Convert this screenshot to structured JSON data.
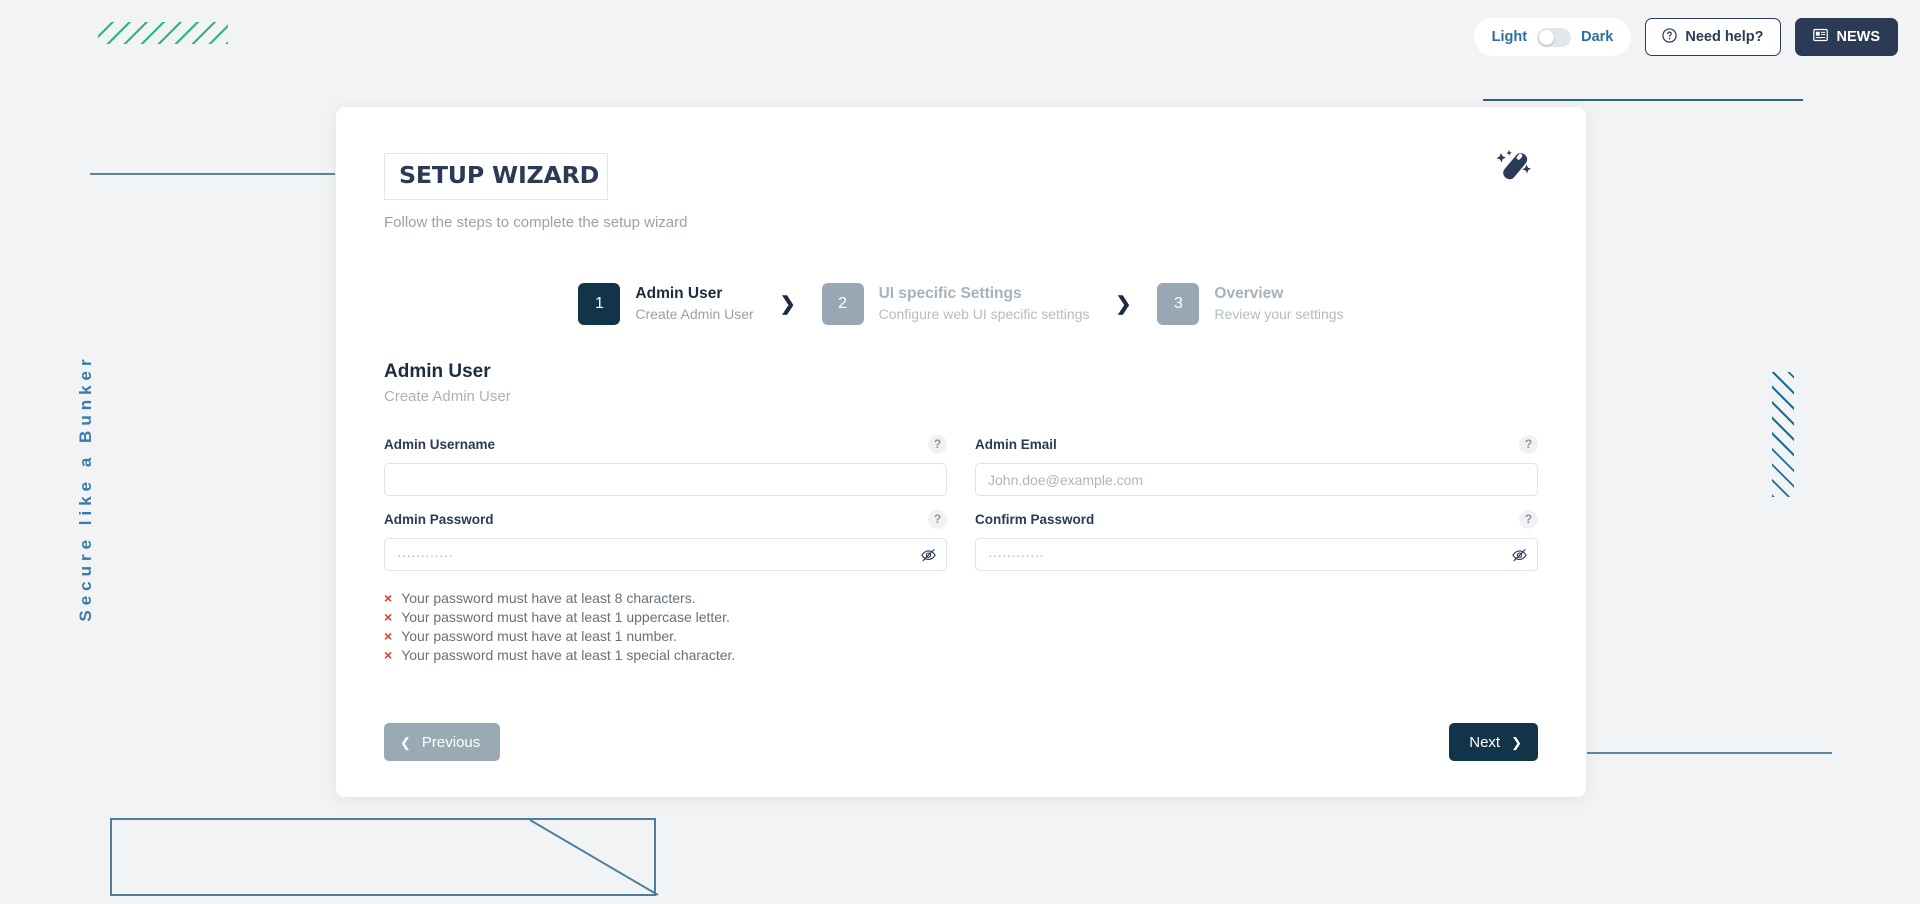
{
  "topbar": {
    "theme_light_label": "Light",
    "theme_dark_label": "Dark",
    "theme_selected": "Light",
    "help_label": "Need help?",
    "help_icon": "question-circle-icon",
    "news_label": "NEWS",
    "news_icon": "news-card-icon"
  },
  "decorations": {
    "tagline": "Secure like a Bunker",
    "green_hatch_color": "#2eb873",
    "blue_hatch_color": "#1a6f96",
    "line_color": "#5b86a3",
    "rect_color": "#4d7d9c"
  },
  "card": {
    "logo_text": "SETUP WIZARD",
    "subtitle": "Follow the steps to complete the setup wizard",
    "wand_icon": "magic-wand-icon"
  },
  "stepper": {
    "separator": "❯",
    "steps": [
      {
        "number": "1",
        "title": "Admin User",
        "desc": "Create Admin User",
        "state": "active"
      },
      {
        "number": "2",
        "title": "UI specific Settings",
        "desc": "Configure web UI specific settings",
        "state": "inactive"
      },
      {
        "number": "3",
        "title": "Overview",
        "desc": "Review your settings",
        "state": "inactive"
      }
    ]
  },
  "section": {
    "title": "Admin User",
    "subtitle": "Create Admin User"
  },
  "fields": {
    "help_glyph": "?",
    "username": {
      "label": "Admin Username",
      "value": "",
      "placeholder": ""
    },
    "email": {
      "label": "Admin Email",
      "value": "",
      "placeholder": "John.doe@example.com"
    },
    "password": {
      "label": "Admin Password",
      "value": "",
      "placeholder": "············",
      "reveal_icon": "eye-off-icon"
    },
    "confirm_password": {
      "label": "Confirm Password",
      "value": "",
      "placeholder": "············",
      "reveal_icon": "eye-off-icon"
    }
  },
  "password_rules": {
    "mark": "×",
    "mark_color": "#e8392c",
    "items": [
      "Your password must have at least 8 characters.",
      "Your password must have at least 1 uppercase letter.",
      "Your password must have at least 1 number.",
      "Your password must have at least 1 special character."
    ]
  },
  "footer": {
    "previous_label": "Previous",
    "previous_icon": "chevron-left-icon",
    "previous_disabled": true,
    "next_label": "Next",
    "next_icon": "chevron-right-icon",
    "next_color": "#123449"
  }
}
